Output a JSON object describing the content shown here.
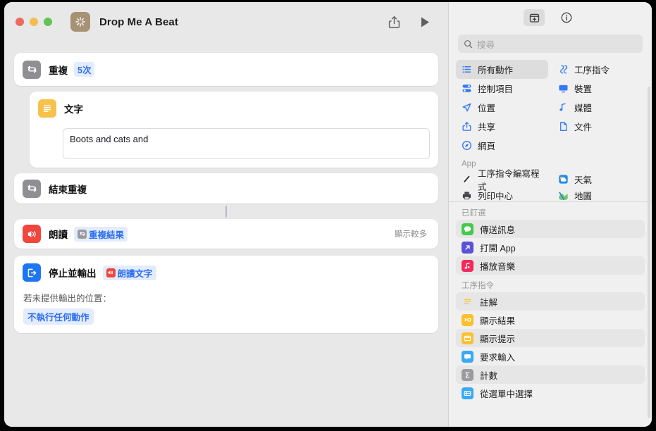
{
  "window": {
    "title": "Drop Me A Beat",
    "app_icon": "shortcuts-app-icon",
    "traffic_lights": [
      "close",
      "minimize",
      "zoom"
    ]
  },
  "toolbar": {
    "share_label": "share-icon",
    "play_label": "play-icon"
  },
  "workflow": {
    "actions": [
      {
        "name": "repeat",
        "title": "重複",
        "token": "5次",
        "icon": "repeat-icon",
        "icon_color": "#8e8e93"
      },
      {
        "name": "text",
        "title": "文字",
        "value": "Boots and cats and",
        "icon": "text-icon",
        "icon_color": "#f7c14b"
      },
      {
        "name": "end-repeat",
        "title": "結束重複",
        "icon": "repeat-icon",
        "icon_color": "#8e8e93"
      },
      {
        "name": "speak-text",
        "title": "朗讀",
        "token": "重複結果",
        "show_more": "顯示較多",
        "icon": "speaker-icon",
        "icon_color": "#f0463c"
      },
      {
        "name": "stop-and-output",
        "title": "停止並輸出",
        "token": "朗讀文字",
        "sub_label": "若未提供輸出的位置：",
        "sub_value": "不執行任何動作",
        "icon": "exit-icon",
        "icon_color": "#1d76f2"
      }
    ]
  },
  "sidebar": {
    "toolbar": {
      "library_button": "action-library-icon",
      "info_button": "info-icon"
    },
    "search": {
      "placeholder": "搜尋",
      "value": ""
    },
    "categories": [
      {
        "label": "所有動作",
        "icon": "list-icon",
        "selected": true
      },
      {
        "label": "工序指令",
        "icon": "shortcuts-icon",
        "selected": false
      },
      {
        "label": "控制項目",
        "icon": "controls-icon",
        "selected": false
      },
      {
        "label": "裝置",
        "icon": "display-icon",
        "selected": false
      },
      {
        "label": "位置",
        "icon": "location-icon",
        "selected": false
      },
      {
        "label": "媒體",
        "icon": "music-note-icon",
        "selected": false
      },
      {
        "label": "共享",
        "icon": "share-icon",
        "selected": false
      },
      {
        "label": "文件",
        "icon": "document-icon",
        "selected": false
      },
      {
        "label": "網頁",
        "icon": "safari-icon",
        "selected": false
      }
    ],
    "sections": [
      {
        "title": "App",
        "layout": "grid",
        "items": [
          {
            "label": "工序指令編寫程式",
            "icon": "script-editor-icon"
          },
          {
            "label": "天氣",
            "icon": "weather-icon"
          },
          {
            "label": "列印中心",
            "icon": "printer-icon"
          },
          {
            "label": "地圖",
            "icon": "maps-icon"
          }
        ]
      },
      {
        "title": "已釘選",
        "layout": "list",
        "items": [
          {
            "label": "傳送訊息",
            "icon": "messages-icon",
            "highlight": true
          },
          {
            "label": "打開 App",
            "icon": "open-app-icon",
            "highlight": false
          },
          {
            "label": "播放音樂",
            "icon": "music-icon",
            "highlight": true
          }
        ]
      },
      {
        "title": "工序指令",
        "layout": "list",
        "items": [
          {
            "label": "註解",
            "icon": "comment-icon",
            "highlight": true
          },
          {
            "label": "顯示結果",
            "icon": "show-result-icon",
            "highlight": false
          },
          {
            "label": "顯示提示",
            "icon": "show-alert-icon",
            "highlight": true
          },
          {
            "label": "要求輸入",
            "icon": "ask-input-icon",
            "highlight": false
          },
          {
            "label": "計數",
            "icon": "count-icon",
            "highlight": true
          },
          {
            "label": "從選單中選擇",
            "icon": "choose-menu-icon",
            "highlight": false
          }
        ]
      }
    ]
  },
  "colors": {
    "accent_blue": "#2f6ff0",
    "window_bg": "#e8e8e8",
    "sidebar_bg": "#f0f0f0",
    "card_bg": "#ffffff"
  }
}
